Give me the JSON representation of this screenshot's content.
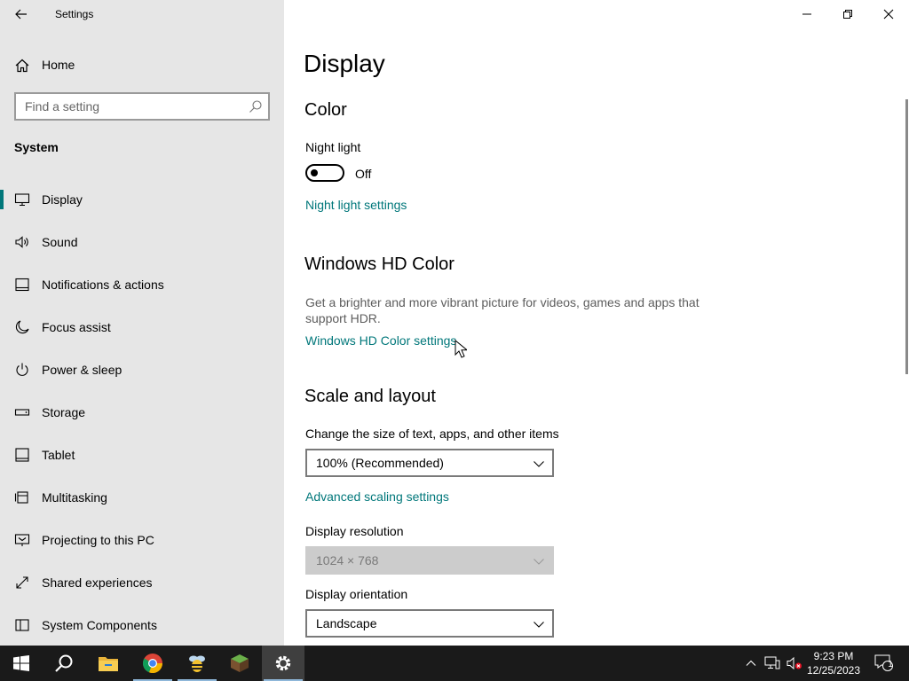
{
  "window": {
    "title": "Settings",
    "controls": [
      "minimize",
      "restore",
      "close"
    ]
  },
  "sidebar": {
    "home_label": "Home",
    "search_placeholder": "Find a setting",
    "section_header": "System",
    "items": [
      {
        "label": "Display",
        "icon": "monitor-icon",
        "active": true
      },
      {
        "label": "Sound",
        "icon": "speaker-icon"
      },
      {
        "label": "Notifications & actions",
        "icon": "notifications-icon"
      },
      {
        "label": "Focus assist",
        "icon": "moon-icon"
      },
      {
        "label": "Power & sleep",
        "icon": "power-icon"
      },
      {
        "label": "Storage",
        "icon": "storage-icon"
      },
      {
        "label": "Tablet",
        "icon": "tablet-icon"
      },
      {
        "label": "Multitasking",
        "icon": "multitasking-icon"
      },
      {
        "label": "Projecting to this PC",
        "icon": "projecting-icon"
      },
      {
        "label": "Shared experiences",
        "icon": "shared-icon"
      },
      {
        "label": "System Components",
        "icon": "components-icon"
      }
    ]
  },
  "main": {
    "page_title": "Display",
    "color": {
      "heading": "Color",
      "night_light_label": "Night light",
      "night_light_state": "Off",
      "night_light_on": false,
      "night_light_link": "Night light settings"
    },
    "hd_color": {
      "heading": "Windows HD Color",
      "description": "Get a brighter and more vibrant picture for videos, games and apps that support HDR.",
      "link": "Windows HD Color settings"
    },
    "scale": {
      "heading": "Scale and layout",
      "size_label": "Change the size of text, apps, and other items",
      "size_value": "100% (Recommended)",
      "advanced_link": "Advanced scaling settings",
      "resolution_label": "Display resolution",
      "resolution_value": "1024 × 768",
      "orientation_label": "Display orientation",
      "orientation_value": "Landscape"
    }
  },
  "taskbar": {
    "apps": [
      "start-icon",
      "search-icon",
      "file-explorer-icon",
      "chrome-icon",
      "bee-app-icon",
      "minecraft-icon",
      "settings-icon"
    ],
    "clock_time": "9:23 PM",
    "clock_date": "12/25/2023",
    "notification_count": "1"
  },
  "colors": {
    "accent": "#00777a",
    "sidebar_bg": "#e6e6e6",
    "taskbar_bg": "#1a1a1a"
  }
}
